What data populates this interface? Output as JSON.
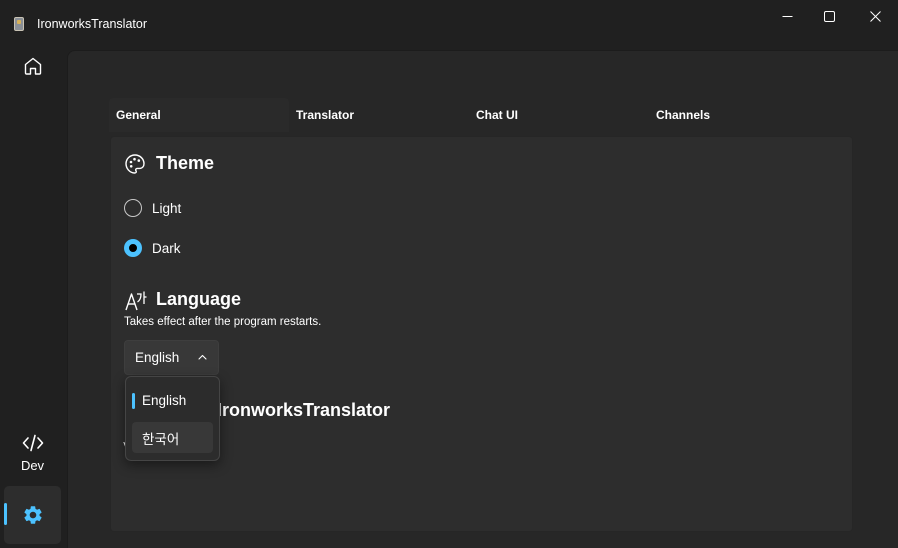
{
  "window": {
    "title": "IronworksTranslator",
    "controls": [
      "minimize-icon",
      "maximize-icon",
      "close-icon"
    ]
  },
  "nav": {
    "items": [
      {
        "icon": "home-icon",
        "label": ""
      },
      {
        "icon": "code-icon",
        "label": "Dev"
      },
      {
        "icon": "gear-icon",
        "label": "",
        "selected": true
      }
    ]
  },
  "tabs": [
    {
      "label": "General",
      "selected": true
    },
    {
      "label": "Translator"
    },
    {
      "label": "Chat UI"
    },
    {
      "label": "Channels"
    }
  ],
  "theme": {
    "title": "Theme",
    "icon": "palette-icon",
    "options": [
      {
        "label": "Light",
        "checked": false
      },
      {
        "label": "Dark",
        "checked": true
      }
    ]
  },
  "language": {
    "title": "Language",
    "icon": "language-icon",
    "description": "Takes effect after the program restarts.",
    "selected": "English",
    "options": [
      "English",
      "한국어"
    ],
    "dropdown_open": true
  },
  "about": {
    "title": "IronworksTranslator",
    "partial_glyph": "v"
  },
  "colors": {
    "accent": "#4cc2ff",
    "background": "#202020",
    "content": "#272727",
    "panel": "#2d2d2d"
  }
}
